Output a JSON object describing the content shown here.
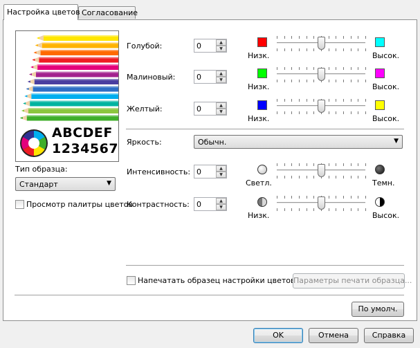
{
  "tabs": [
    {
      "label": "Настройка цветов",
      "active": true
    },
    {
      "label": "Согласование",
      "active": false
    }
  ],
  "preview": {
    "letters": "ABCDEF",
    "digits": "1234567",
    "pencil_colors": [
      "#ffe600",
      "#ffb300",
      "#ff6a00",
      "#ee1c24",
      "#e4007c",
      "#a3228f",
      "#4a3ea0",
      "#2e6fc5",
      "#00aeef",
      "#00b4a0",
      "#8cc63f",
      "#3fae2a"
    ]
  },
  "sample_type": {
    "label": "Тип образца:",
    "value": "Стандарт"
  },
  "palette_preview": {
    "label": "Просмотр палитры цветов",
    "checked": false
  },
  "color_rows": [
    {
      "label": "Голубой:",
      "value": "0",
      "low_label": "Низк.",
      "high_label": "Высок.",
      "low_color": "#ff0000",
      "high_color": "#00ffff",
      "level": 0.5
    },
    {
      "label": "Малиновый:",
      "value": "0",
      "low_label": "Низк.",
      "high_label": "Высок.",
      "low_color": "#00ff00",
      "high_color": "#ff00ff",
      "level": 0.5
    },
    {
      "label": "Желтый:",
      "value": "0",
      "low_label": "Низк.",
      "high_label": "Высок.",
      "low_color": "#0000ff",
      "high_color": "#ffff00",
      "level": 0.5
    }
  ],
  "brightness": {
    "label": "Яркость:",
    "value": "Обычн."
  },
  "intensity": {
    "label": "Интенсивность:",
    "value": "0",
    "low_label": "Светл.",
    "high_label": "Темн.",
    "level": 0.5
  },
  "contrast": {
    "label": "Контрастность:",
    "value": "0",
    "low_label": "Низк.",
    "high_label": "Высок.",
    "level": 0.5
  },
  "print_sample": {
    "label": "Напечатать образец настройки цветов",
    "checked": false
  },
  "print_params_button": "Параметры печати образца...",
  "defaults_button": "По умолч.",
  "footer": {
    "ok": "OK",
    "cancel": "Отмена",
    "help": "Справка"
  },
  "icons": {
    "up": "▲",
    "down": "▼",
    "combo_arrow": "▼"
  }
}
